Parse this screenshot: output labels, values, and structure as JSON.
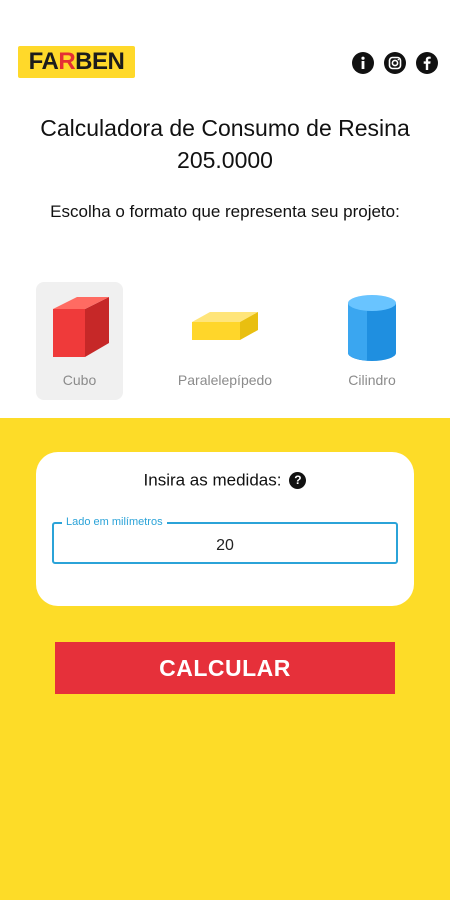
{
  "header": {
    "logo_left": "FA",
    "logo_accent": "R",
    "logo_right": "BEN",
    "social_icons": [
      "info-icon",
      "instagram-icon",
      "facebook-icon"
    ]
  },
  "main": {
    "title": "Calculadora de Consumo de Resina 205.0000",
    "subtitle": "Escolha o formato que representa seu projeto:"
  },
  "shapes": [
    {
      "label": "Cubo",
      "icon": "cube-icon",
      "selected": true
    },
    {
      "label": "Paralelepípedo",
      "icon": "box-icon",
      "selected": false
    },
    {
      "label": "Cilindro",
      "icon": "cylinder-icon",
      "selected": false
    }
  ],
  "form": {
    "heading": "Insira as medidas:",
    "help_icon": "?",
    "field_label": "Lado em milímetros",
    "field_value": "20"
  },
  "calculate_label": "CALCULAR",
  "colors": {
    "brand_yellow": "#fddc28",
    "button_red": "#e6303a",
    "field_blue": "#2ba3d8"
  }
}
